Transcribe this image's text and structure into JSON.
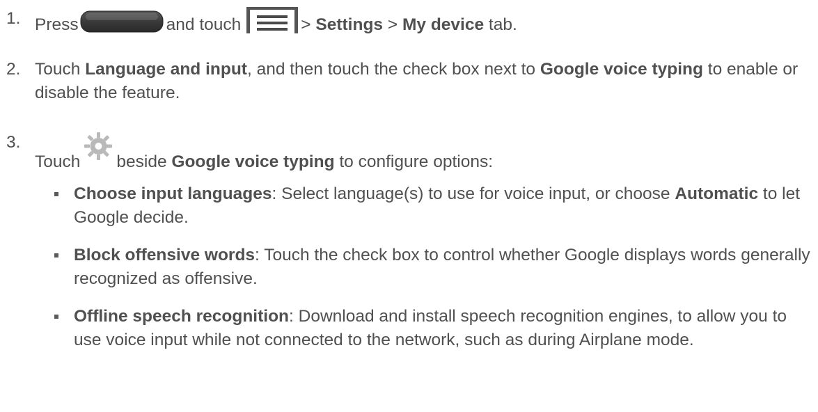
{
  "steps": [
    {
      "number": "1.",
      "t1": "Press",
      "home_icon": "home-key-icon",
      "t2": "and touch",
      "menu_icon": "menu-key-icon",
      "t3": ">",
      "b1": "Settings",
      "t4": ">",
      "b2": "My device",
      "t5": "tab."
    },
    {
      "number": "2.",
      "t1": "Touch",
      "b1": "Language and input",
      "t2": ", and then touch the check box next to",
      "b2": "Google voice typing",
      "t3": "to enable or disable the feature."
    },
    {
      "number": "3.",
      "t1": "Touch",
      "gear_icon": "gear-icon",
      "t2": "beside",
      "b1": "Google voice typing",
      "t3": "to configure options:"
    }
  ],
  "options": [
    {
      "title": "Choose input languages",
      "t1": ": Select language(s) to use for voice input, or choose",
      "b1": "Automatic",
      "t2": "to let Google decide."
    },
    {
      "title": "Block offensive words",
      "t1": ": Touch the check box to control whether Google displays words generally recognized as offensive."
    },
    {
      "title": "Offline speech recognition",
      "t1": ": Download and install speech recognition engines, to allow you to use voice input while not connected to the network, such as during Airplane mode."
    }
  ],
  "colors": {
    "text": "#505050",
    "key_body": "#3f3f3f",
    "menu_bars": "#4a4a4a",
    "gear": "#b8b8b8"
  }
}
